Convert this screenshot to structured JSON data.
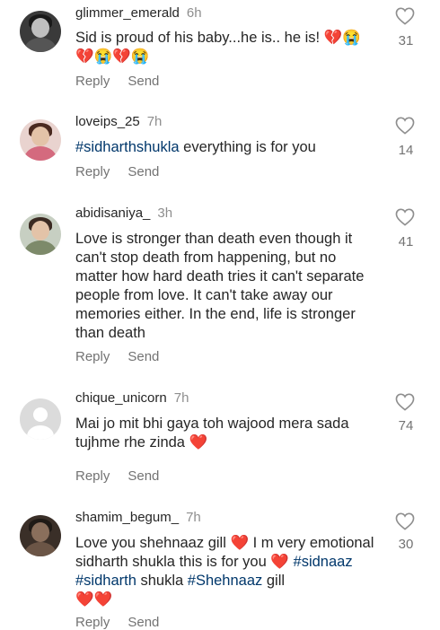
{
  "comments": [
    {
      "username": "glimmer_emerald",
      "time": "6h",
      "text_line1": "Sid is proud of his baby...he is.. he is!",
      "emojis_line1": "💔😭",
      "emojis_line2": "💔😭💔😭",
      "reply_label": "Reply",
      "send_label": "Send",
      "likes": "31"
    },
    {
      "username": "loveips_25",
      "time": "7h",
      "hashtag": "#sidharthshukla",
      "text": " everything is for you",
      "reply_label": "Reply",
      "send_label": "Send",
      "likes": "14"
    },
    {
      "username": "abidisaniya_",
      "time": "3h",
      "text": "Love is stronger than death even though it can't stop death from happening, but no matter how hard death tries it can't separate people from love. It can't take away our memories either. In the end, life is stronger than death",
      "reply_label": "Reply",
      "send_label": "Send",
      "likes": "41"
    },
    {
      "username": "chique_unicorn",
      "time": "7h",
      "text": "Mai jo mit bhi gaya toh wajood mera sada tujhme rhe zinda",
      "emoji": "❤️",
      "reply_label": "Reply",
      "send_label": "Send",
      "likes": "74"
    },
    {
      "username": "shamim_begum_",
      "time": "7h",
      "text_a": "Love you shehnaaz gill",
      "emoji_a": "❤️",
      "text_b": " I m very emotional sidharth shukla this is for you",
      "emoji_b": "❤️",
      "tag1": "#sidnaaz",
      "tag2": "#sidharth",
      "text_c": " shukla ",
      "tag3": "#Shehnaaz",
      "text_d": " gill",
      "emoji_c": "❤️❤️",
      "reply_label": "Reply",
      "send_label": "Send",
      "likes": "30"
    }
  ]
}
